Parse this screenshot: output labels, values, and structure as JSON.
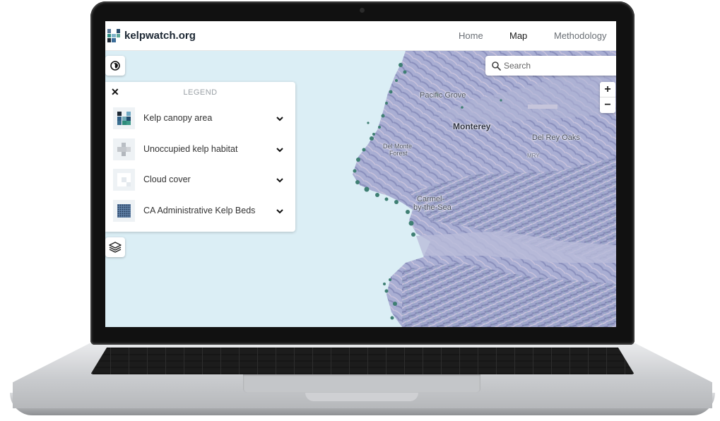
{
  "site": {
    "logo_text": "kelpwatch.org",
    "nav": {
      "home": "Home",
      "map": "Map",
      "methodology": "Methodology"
    }
  },
  "search": {
    "placeholder": "Search",
    "value": ""
  },
  "zoom": {
    "in_label": "+",
    "out_label": "−"
  },
  "legend": {
    "close_label": "✕",
    "title": "LEGEND",
    "items": [
      {
        "label": "Kelp canopy area",
        "icon": "kelp-canopy-icon"
      },
      {
        "label": "Unoccupied kelp habitat",
        "icon": "unoccupied-habitat-icon"
      },
      {
        "label": "Cloud cover",
        "icon": "cloud-cover-icon"
      },
      {
        "label": "CA Administrative Kelp Beds",
        "icon": "admin-kelp-beds-icon"
      }
    ]
  },
  "map": {
    "labels": {
      "pacific_grove": "Pacific Grove",
      "monterey": "Monterey",
      "del_rey_oaks": "Del Rey Oaks",
      "mry": "MRY",
      "del_monte_forest_1": "Del Monte",
      "del_monte_forest_2": "Forest",
      "carmel_1": "Carmel-",
      "carmel_2": "by-the-Sea"
    }
  },
  "colors": {
    "ocean": "#dbeef5",
    "land": "#a6acd1",
    "kelp": "#3f7f73",
    "brand_dark": "#1c2733"
  }
}
